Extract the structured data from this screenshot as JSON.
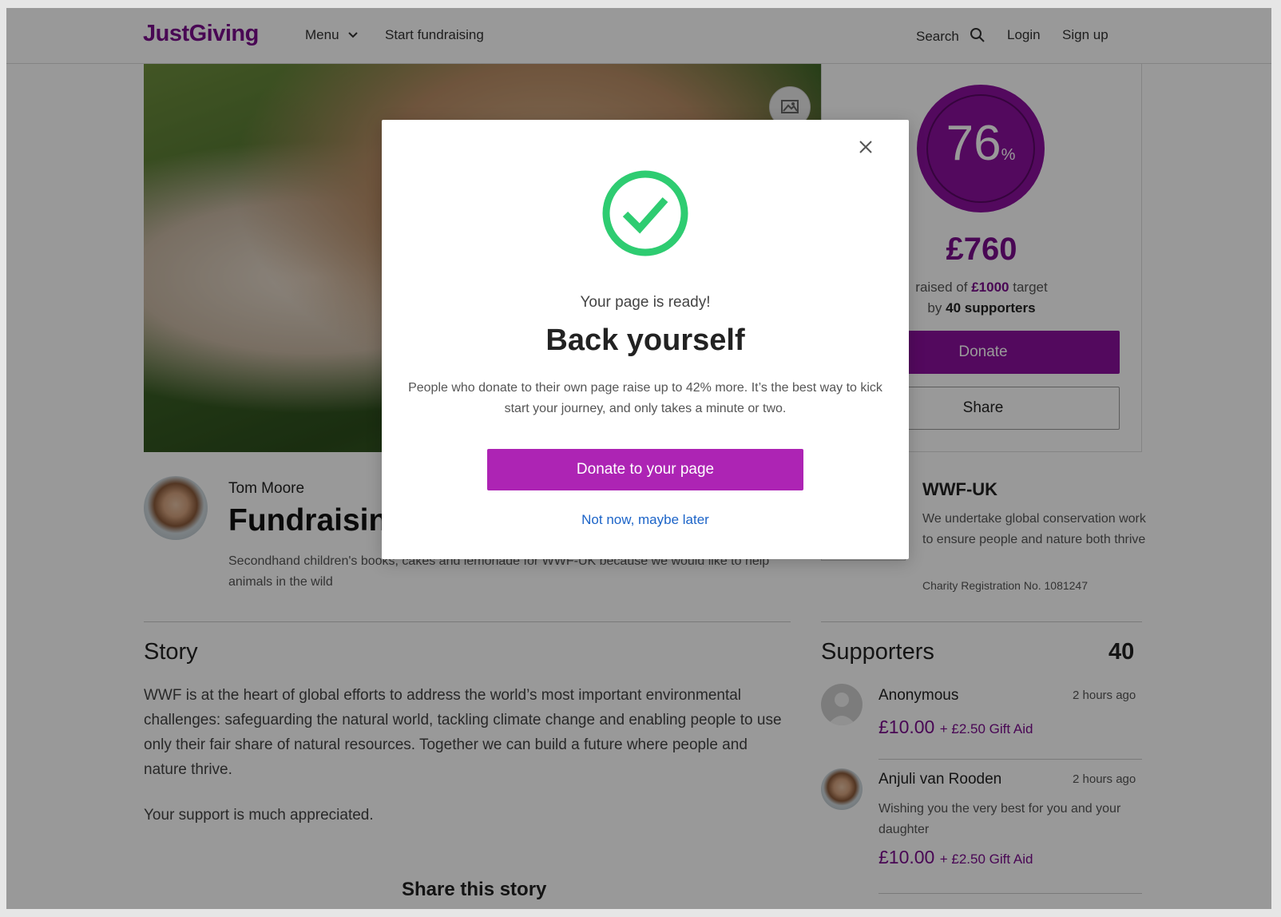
{
  "header": {
    "logo": "JustGiving",
    "menu_label": "Menu",
    "start_fundraising": "Start fundraising",
    "search_label": "Search",
    "login": "Login",
    "signup": "Sign up"
  },
  "progress": {
    "percent": "76",
    "percent_sign": "%",
    "amount": "£760",
    "raised_prefix": "raised of",
    "target": "£1000",
    "target_suffix": "target",
    "by_prefix": "by",
    "supporters": "40 supporters",
    "donate_label": "Donate",
    "share_label": "Share"
  },
  "owner": {
    "name": "Tom Moore",
    "title": "Fundraising for WWF-UK",
    "description": "Secondhand children's books, cakes and lemonade for WWF-UK because we would like to help animals in the wild"
  },
  "charity": {
    "name": "WWF-UK",
    "description": "We undertake global conservation work to ensure people and nature both thrive",
    "registration": "Charity Registration No. 1081247"
  },
  "story": {
    "heading": "Story",
    "paragraph1": "WWF is at the heart of global efforts to address the world’s most important environmental challenges: safeguarding the natural world, tackling climate change and enabling people to use only their fair share of natural resources. Together we can build a future where people and nature thrive.",
    "paragraph2": "Your support is much appreciated.",
    "share_heading": "Share this story"
  },
  "supporters": {
    "heading": "Supporters",
    "count": "40",
    "items": [
      {
        "name": "Anonymous",
        "time": "2 hours ago",
        "amount": "£10.00",
        "gift_aid": "+ £2.50 Gift Aid",
        "message": ""
      },
      {
        "name": "Anjuli van Rooden",
        "time": "2 hours ago",
        "amount": "£10.00",
        "gift_aid": "+ £2.50 Gift Aid",
        "message": "Wishing you the very best for you and your daughter"
      }
    ]
  },
  "modal": {
    "close_icon": "close-icon",
    "kicker": "Your page is ready!",
    "title": "Back yourself",
    "body": "People who donate to their own page raise up to 42% more. It’s the best way to kick start your journey, and only takes a minute or two.",
    "primary_button": "Donate to your page",
    "secondary_link": "Not now, maybe later"
  },
  "colors": {
    "brand": "#7a0c8d",
    "modal_button": "#ad24b4",
    "check": "#2ecc71",
    "link": "#1c64c8"
  }
}
